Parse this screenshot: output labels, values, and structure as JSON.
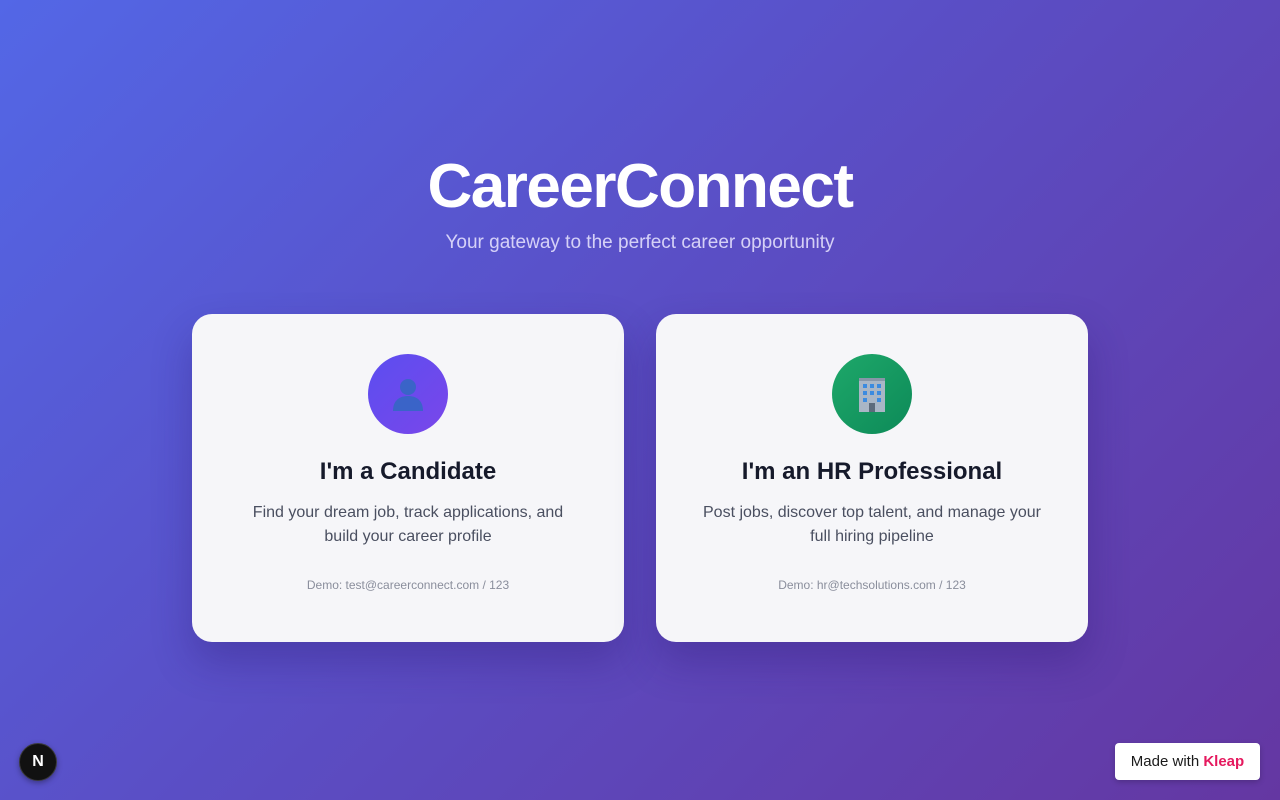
{
  "hero": {
    "title": "CareerConnect",
    "subtitle": "Your gateway to the perfect career opportunity"
  },
  "cards": [
    {
      "icon": "user-icon",
      "icon_color": "#6a4bee",
      "title": "I'm a Candidate",
      "description": "Find your dream job, track applications, and build your career profile",
      "demo": "Demo: test@careerconnect.com / 123"
    },
    {
      "icon": "office-building-icon",
      "icon_color": "#179a63",
      "title": "I'm an HR Professional",
      "description": "Post jobs, discover top talent, and manage your full hiring pipeline",
      "demo": "Demo: hr@techsolutions.com / 123"
    }
  ],
  "footer": {
    "badge_letter": "N",
    "made_with_prefix": "Made with",
    "made_with_brand": "Kleap",
    "brand_color": "#e5195e"
  },
  "colors": {
    "background_start": "#5367e6",
    "background_end": "#6437a2",
    "card_background": "#f6f6f9"
  }
}
